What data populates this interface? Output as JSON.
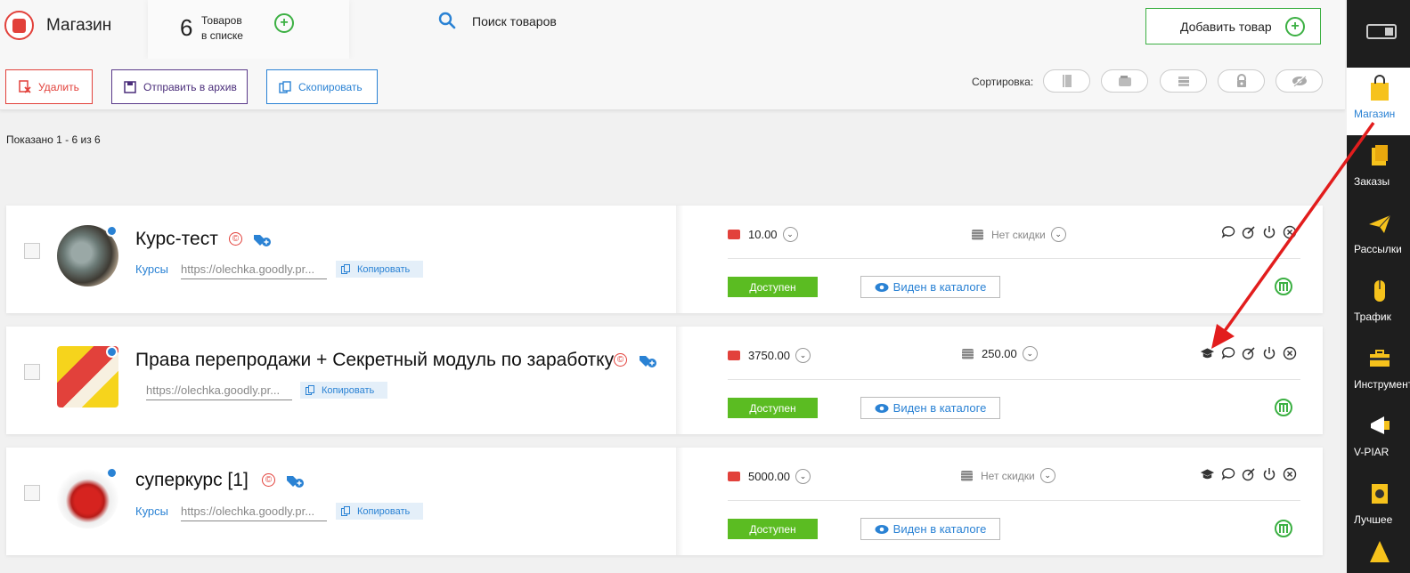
{
  "header": {
    "title": "Магазин",
    "count": "6",
    "count_label_1": "Товаров",
    "count_label_2": "в списке",
    "search_label": "Поиск товаров",
    "add_product_label": "Добавить товар"
  },
  "actions": {
    "delete_label": "Удалить",
    "archive_label": "Отправить в архив",
    "copy_label": "Скопировать",
    "sort_label": "Сортировка:",
    "sort_icons": [
      "notebook-icon",
      "wallet-icon",
      "coins-icon",
      "lock-icon",
      "eye-hidden-icon"
    ]
  },
  "listing": {
    "shown_text": "Показано 1 - 6 из 6"
  },
  "products": [
    {
      "title": "Курс-тест",
      "category": "Курсы",
      "url": "https://olechka.goodly.pr...",
      "copy_label": "Копировать",
      "price": "10.00",
      "discount": "Нет скидки",
      "status": "Доступен",
      "visibility": "Виден в каталоге"
    },
    {
      "title": "Права перепродажи + Секретный модуль по заработку",
      "category": "",
      "url": "https://olechka.goodly.pr...",
      "copy_label": "Копировать",
      "price": "3750.00",
      "discount": "250.00",
      "status": "Доступен",
      "visibility": "Виден в каталоге"
    },
    {
      "title": "суперкурс [1]",
      "category": "Курсы",
      "url": "https://olechka.goodly.pr...",
      "copy_label": "Копировать",
      "price": "5000.00",
      "discount": "Нет скидки",
      "status": "Доступен",
      "visibility": "Виден в каталоге"
    }
  ],
  "sidebar": {
    "items": [
      {
        "label": "Магазин",
        "icon": "shopping-bag-icon",
        "active": true
      },
      {
        "label": "Заказы",
        "icon": "orders-icon",
        "active": false
      },
      {
        "label": "Рассылки",
        "icon": "mailing-icon",
        "active": false
      },
      {
        "label": "Трафик",
        "icon": "traffic-icon",
        "active": false
      },
      {
        "label": "Инструменты",
        "icon": "tools-icon",
        "active": false
      },
      {
        "label": "V-PIAR",
        "icon": "megaphone-icon",
        "active": false
      },
      {
        "label": "Лучшее",
        "icon": "best-icon",
        "active": false
      }
    ]
  },
  "colors": {
    "accent_red": "#e2413b",
    "accent_green": "#3cb043",
    "accent_blue": "#2a82d4",
    "status_green": "#5bbc22",
    "sidebar_bg": "#1e1e1e"
  }
}
